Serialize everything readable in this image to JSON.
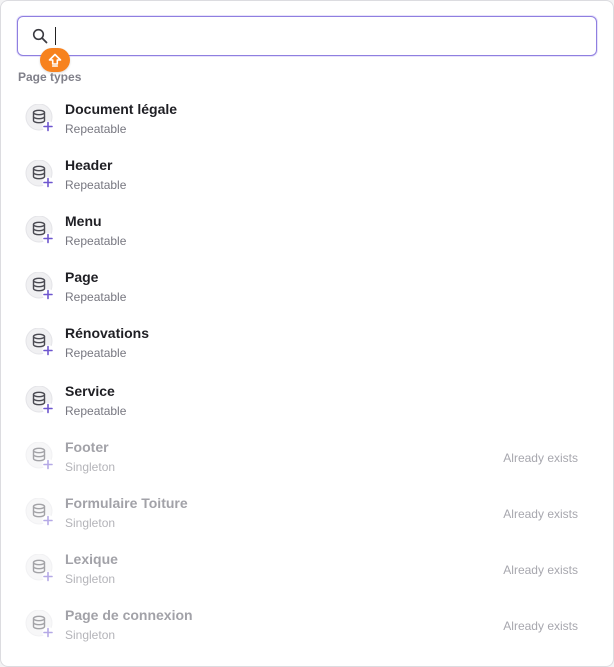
{
  "search": {
    "value": "",
    "placeholder": ""
  },
  "shortcut_badge": {
    "icon": "shift-arrow-icon",
    "color": "#f7821e"
  },
  "section": {
    "title": "Page types"
  },
  "items": [
    {
      "title": "Document légale",
      "subtitle": "Repeatable",
      "status": "",
      "disabled": false,
      "icon": "database-plus-icon"
    },
    {
      "title": "Header",
      "subtitle": "Repeatable",
      "status": "",
      "disabled": false,
      "icon": "database-plus-icon"
    },
    {
      "title": "Menu",
      "subtitle": "Repeatable",
      "status": "",
      "disabled": false,
      "icon": "database-plus-icon"
    },
    {
      "title": "Page",
      "subtitle": "Repeatable",
      "status": "",
      "disabled": false,
      "icon": "database-plus-icon"
    },
    {
      "title": "Rénovations",
      "subtitle": "Repeatable",
      "status": "",
      "disabled": false,
      "icon": "database-plus-icon"
    },
    {
      "title": "Service",
      "subtitle": "Repeatable",
      "status": "",
      "disabled": false,
      "icon": "database-plus-icon"
    },
    {
      "title": "Footer",
      "subtitle": "Singleton",
      "status": "Already exists",
      "disabled": true,
      "icon": "database-plus-icon"
    },
    {
      "title": "Formulaire Toiture",
      "subtitle": "Singleton",
      "status": "Already exists",
      "disabled": true,
      "icon": "database-plus-icon"
    },
    {
      "title": "Lexique",
      "subtitle": "Singleton",
      "status": "Already exists",
      "disabled": true,
      "icon": "database-plus-icon"
    },
    {
      "title": "Page de connexion",
      "subtitle": "Singleton",
      "status": "Already exists",
      "disabled": true,
      "icon": "database-plus-icon"
    }
  ],
  "colors": {
    "accent": "#6e56cf",
    "focus_border": "#8f7fe0",
    "badge": "#f7821e"
  }
}
